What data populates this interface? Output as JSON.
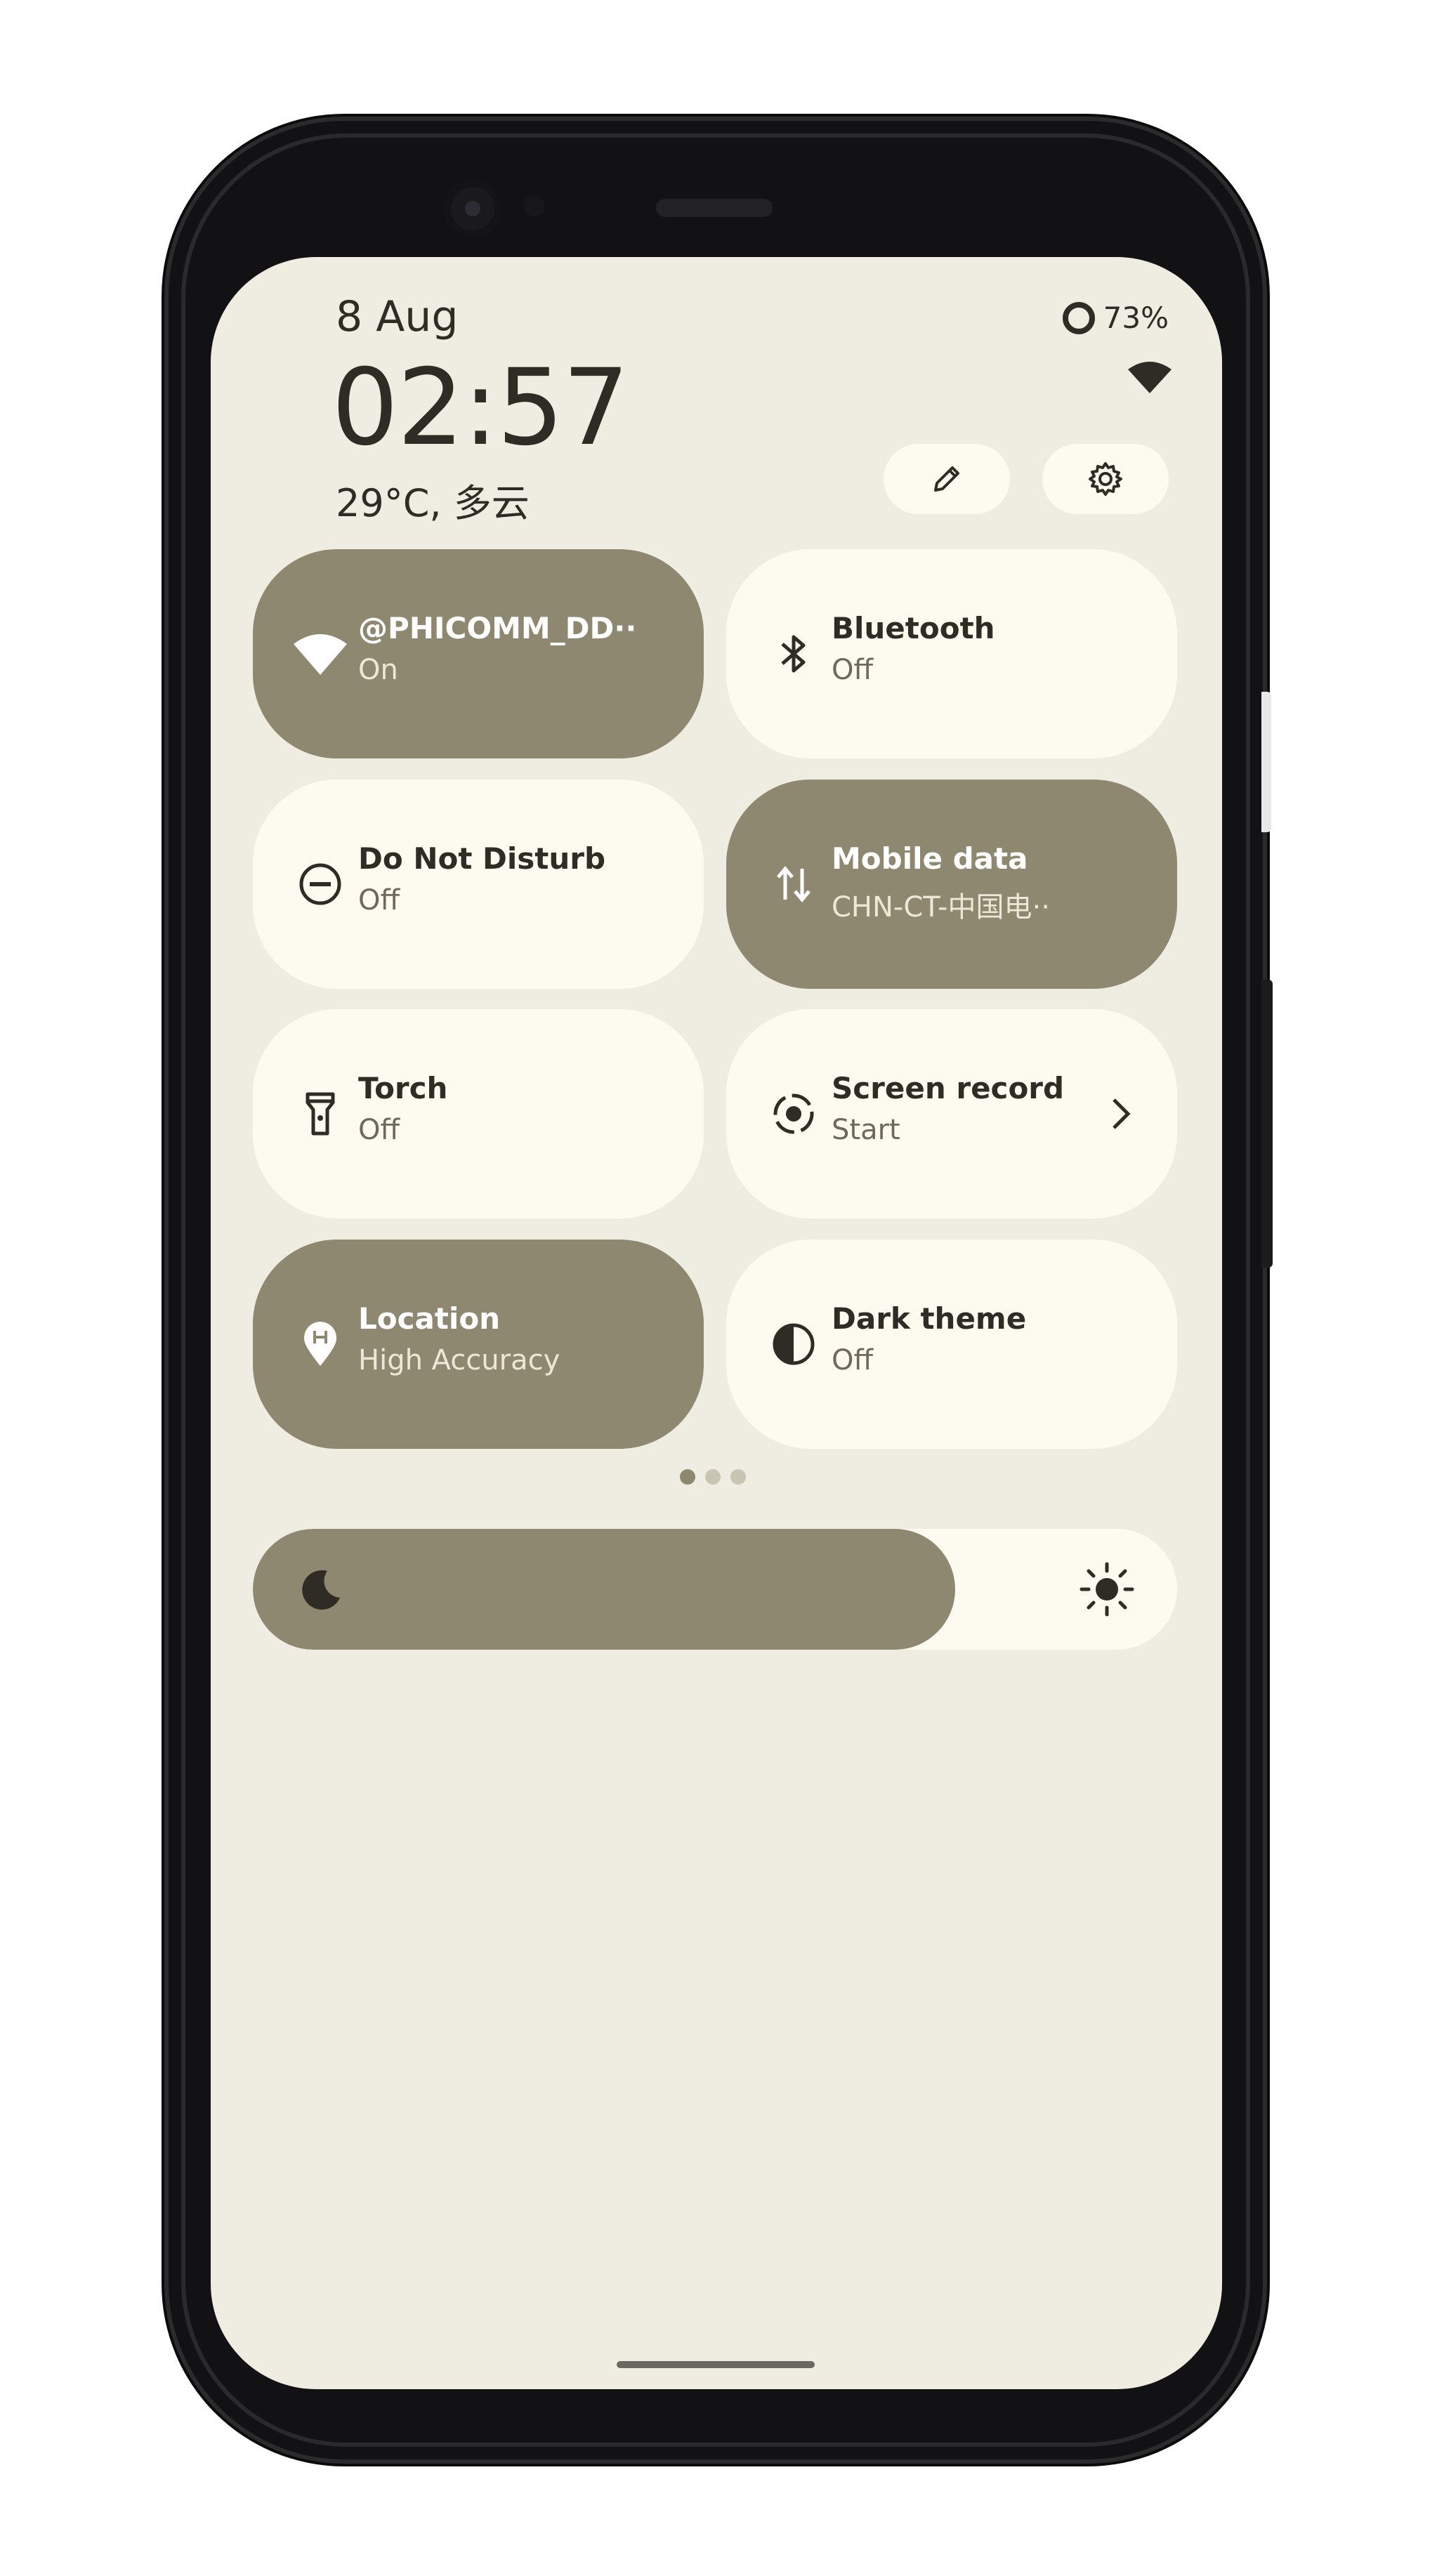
{
  "status": {
    "date": "8 Aug",
    "battery": "73%",
    "clock": "02:57",
    "weather": "29°C, 多云"
  },
  "header_buttons": {
    "edit_icon": "pencil-icon",
    "settings_icon": "gear-icon"
  },
  "tiles": [
    {
      "label": "@PHICOMM_DD··",
      "sub": "On",
      "state": "on",
      "icon": "wifi-icon"
    },
    {
      "label": "Bluetooth",
      "sub": "Off",
      "state": "off",
      "icon": "bluetooth-icon"
    },
    {
      "label": "Do Not Disturb",
      "sub": "Off",
      "state": "off",
      "icon": "do-not-disturb-icon"
    },
    {
      "label": "Mobile data",
      "sub": "CHN-CT-中国电··",
      "state": "on",
      "icon": "mobile-data-icon"
    },
    {
      "label": "Torch",
      "sub": "Off",
      "state": "off",
      "icon": "torch-icon"
    },
    {
      "label": "Screen record",
      "sub": "Start",
      "state": "off",
      "icon": "screen-record-icon"
    },
    {
      "label": "Location",
      "sub": "High Accuracy",
      "state": "on",
      "icon": "location-icon"
    },
    {
      "label": "Dark theme",
      "sub": "Off",
      "state": "off",
      "icon": "dark-theme-icon"
    }
  ],
  "pager": {
    "pages": 3,
    "current": 1
  },
  "brightness": {
    "level": 0.76
  },
  "colors": {
    "tile_on": "#8e8870",
    "tile_off": "#fdfbef",
    "background": "#efece1",
    "text_dark": "#2e2c24"
  }
}
